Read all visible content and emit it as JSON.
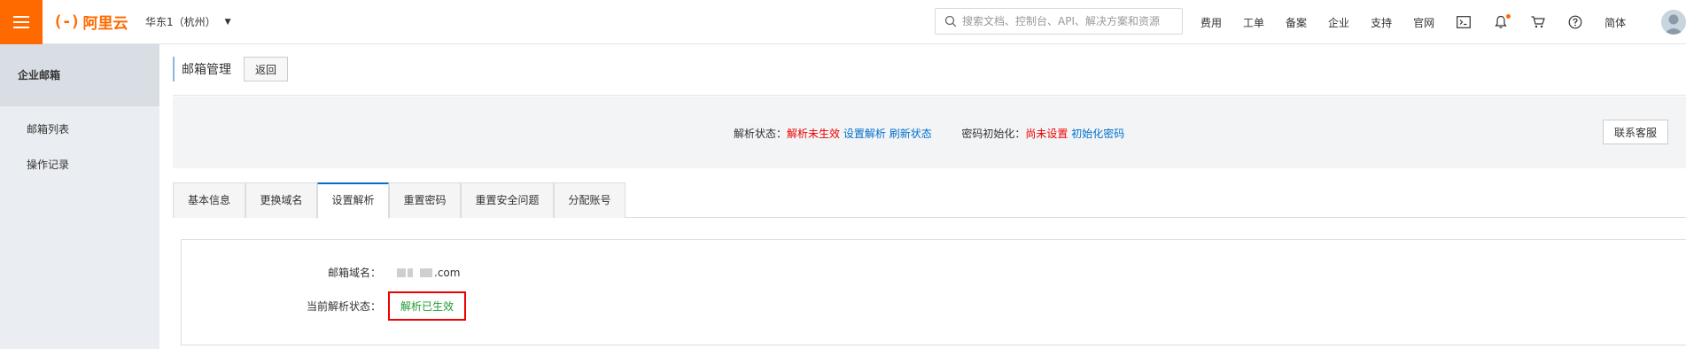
{
  "topbar": {
    "logo_mark": "(-)",
    "logo_text": "阿里云",
    "region": "华东1（杭州）",
    "search_placeholder": "搜索文档、控制台、API、解决方案和资源",
    "nav": [
      "费用",
      "工单",
      "备案",
      "企业",
      "支持",
      "官网"
    ],
    "icons": [
      "terminal-icon",
      "bell-icon",
      "cart-icon",
      "help-icon"
    ],
    "language": "简体",
    "accent": "#ff6a00"
  },
  "sidebar": {
    "title": "企业邮箱",
    "items": [
      "邮箱列表",
      "操作记录"
    ]
  },
  "page": {
    "title": "邮箱管理",
    "back_label": "返回"
  },
  "status": {
    "resolve_label": "解析状态：",
    "resolve_value": "解析未生效",
    "set_resolve": "设置解析",
    "refresh": "刷新状态",
    "pwd_label": "密码初始化：",
    "pwd_value": "尚未设置",
    "pwd_action": "初始化密码",
    "contact_label": "联系客服"
  },
  "tabs": [
    "基本信息",
    "更换域名",
    "设置解析",
    "重置密码",
    "重置安全问题",
    "分配账号"
  ],
  "active_tab": "设置解析",
  "detail": {
    "domain_label": "邮箱域名：",
    "domain_suffix": ".com",
    "current_status_label": "当前解析状态：",
    "current_status_value": "解析已生效"
  }
}
